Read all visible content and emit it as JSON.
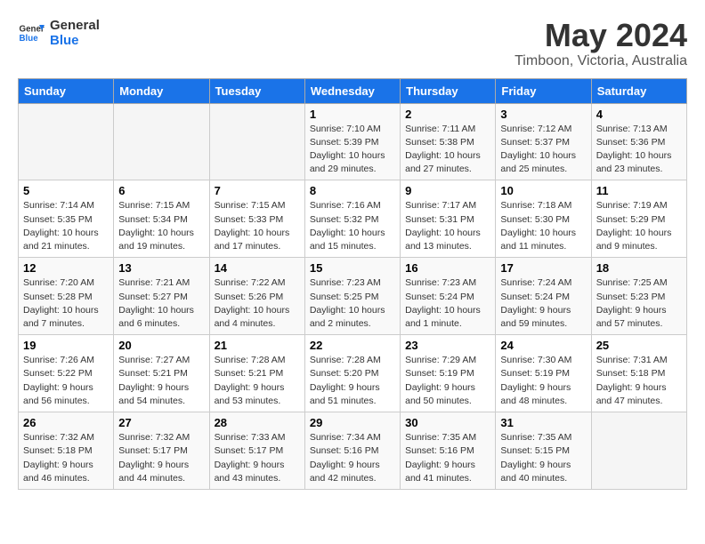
{
  "header": {
    "logo_line1": "General",
    "logo_line2": "Blue",
    "month_year": "May 2024",
    "location": "Timboon, Victoria, Australia"
  },
  "days_of_week": [
    "Sunday",
    "Monday",
    "Tuesday",
    "Wednesday",
    "Thursday",
    "Friday",
    "Saturday"
  ],
  "weeks": [
    [
      {
        "day": "",
        "info": ""
      },
      {
        "day": "",
        "info": ""
      },
      {
        "day": "",
        "info": ""
      },
      {
        "day": "1",
        "info": "Sunrise: 7:10 AM\nSunset: 5:39 PM\nDaylight: 10 hours and 29 minutes."
      },
      {
        "day": "2",
        "info": "Sunrise: 7:11 AM\nSunset: 5:38 PM\nDaylight: 10 hours and 27 minutes."
      },
      {
        "day": "3",
        "info": "Sunrise: 7:12 AM\nSunset: 5:37 PM\nDaylight: 10 hours and 25 minutes."
      },
      {
        "day": "4",
        "info": "Sunrise: 7:13 AM\nSunset: 5:36 PM\nDaylight: 10 hours and 23 minutes."
      }
    ],
    [
      {
        "day": "5",
        "info": "Sunrise: 7:14 AM\nSunset: 5:35 PM\nDaylight: 10 hours and 21 minutes."
      },
      {
        "day": "6",
        "info": "Sunrise: 7:15 AM\nSunset: 5:34 PM\nDaylight: 10 hours and 19 minutes."
      },
      {
        "day": "7",
        "info": "Sunrise: 7:15 AM\nSunset: 5:33 PM\nDaylight: 10 hours and 17 minutes."
      },
      {
        "day": "8",
        "info": "Sunrise: 7:16 AM\nSunset: 5:32 PM\nDaylight: 10 hours and 15 minutes."
      },
      {
        "day": "9",
        "info": "Sunrise: 7:17 AM\nSunset: 5:31 PM\nDaylight: 10 hours and 13 minutes."
      },
      {
        "day": "10",
        "info": "Sunrise: 7:18 AM\nSunset: 5:30 PM\nDaylight: 10 hours and 11 minutes."
      },
      {
        "day": "11",
        "info": "Sunrise: 7:19 AM\nSunset: 5:29 PM\nDaylight: 10 hours and 9 minutes."
      }
    ],
    [
      {
        "day": "12",
        "info": "Sunrise: 7:20 AM\nSunset: 5:28 PM\nDaylight: 10 hours and 7 minutes."
      },
      {
        "day": "13",
        "info": "Sunrise: 7:21 AM\nSunset: 5:27 PM\nDaylight: 10 hours and 6 minutes."
      },
      {
        "day": "14",
        "info": "Sunrise: 7:22 AM\nSunset: 5:26 PM\nDaylight: 10 hours and 4 minutes."
      },
      {
        "day": "15",
        "info": "Sunrise: 7:23 AM\nSunset: 5:25 PM\nDaylight: 10 hours and 2 minutes."
      },
      {
        "day": "16",
        "info": "Sunrise: 7:23 AM\nSunset: 5:24 PM\nDaylight: 10 hours and 1 minute."
      },
      {
        "day": "17",
        "info": "Sunrise: 7:24 AM\nSunset: 5:24 PM\nDaylight: 9 hours and 59 minutes."
      },
      {
        "day": "18",
        "info": "Sunrise: 7:25 AM\nSunset: 5:23 PM\nDaylight: 9 hours and 57 minutes."
      }
    ],
    [
      {
        "day": "19",
        "info": "Sunrise: 7:26 AM\nSunset: 5:22 PM\nDaylight: 9 hours and 56 minutes."
      },
      {
        "day": "20",
        "info": "Sunrise: 7:27 AM\nSunset: 5:21 PM\nDaylight: 9 hours and 54 minutes."
      },
      {
        "day": "21",
        "info": "Sunrise: 7:28 AM\nSunset: 5:21 PM\nDaylight: 9 hours and 53 minutes."
      },
      {
        "day": "22",
        "info": "Sunrise: 7:28 AM\nSunset: 5:20 PM\nDaylight: 9 hours and 51 minutes."
      },
      {
        "day": "23",
        "info": "Sunrise: 7:29 AM\nSunset: 5:19 PM\nDaylight: 9 hours and 50 minutes."
      },
      {
        "day": "24",
        "info": "Sunrise: 7:30 AM\nSunset: 5:19 PM\nDaylight: 9 hours and 48 minutes."
      },
      {
        "day": "25",
        "info": "Sunrise: 7:31 AM\nSunset: 5:18 PM\nDaylight: 9 hours and 47 minutes."
      }
    ],
    [
      {
        "day": "26",
        "info": "Sunrise: 7:32 AM\nSunset: 5:18 PM\nDaylight: 9 hours and 46 minutes."
      },
      {
        "day": "27",
        "info": "Sunrise: 7:32 AM\nSunset: 5:17 PM\nDaylight: 9 hours and 44 minutes."
      },
      {
        "day": "28",
        "info": "Sunrise: 7:33 AM\nSunset: 5:17 PM\nDaylight: 9 hours and 43 minutes."
      },
      {
        "day": "29",
        "info": "Sunrise: 7:34 AM\nSunset: 5:16 PM\nDaylight: 9 hours and 42 minutes."
      },
      {
        "day": "30",
        "info": "Sunrise: 7:35 AM\nSunset: 5:16 PM\nDaylight: 9 hours and 41 minutes."
      },
      {
        "day": "31",
        "info": "Sunrise: 7:35 AM\nSunset: 5:15 PM\nDaylight: 9 hours and 40 minutes."
      },
      {
        "day": "",
        "info": ""
      }
    ]
  ]
}
